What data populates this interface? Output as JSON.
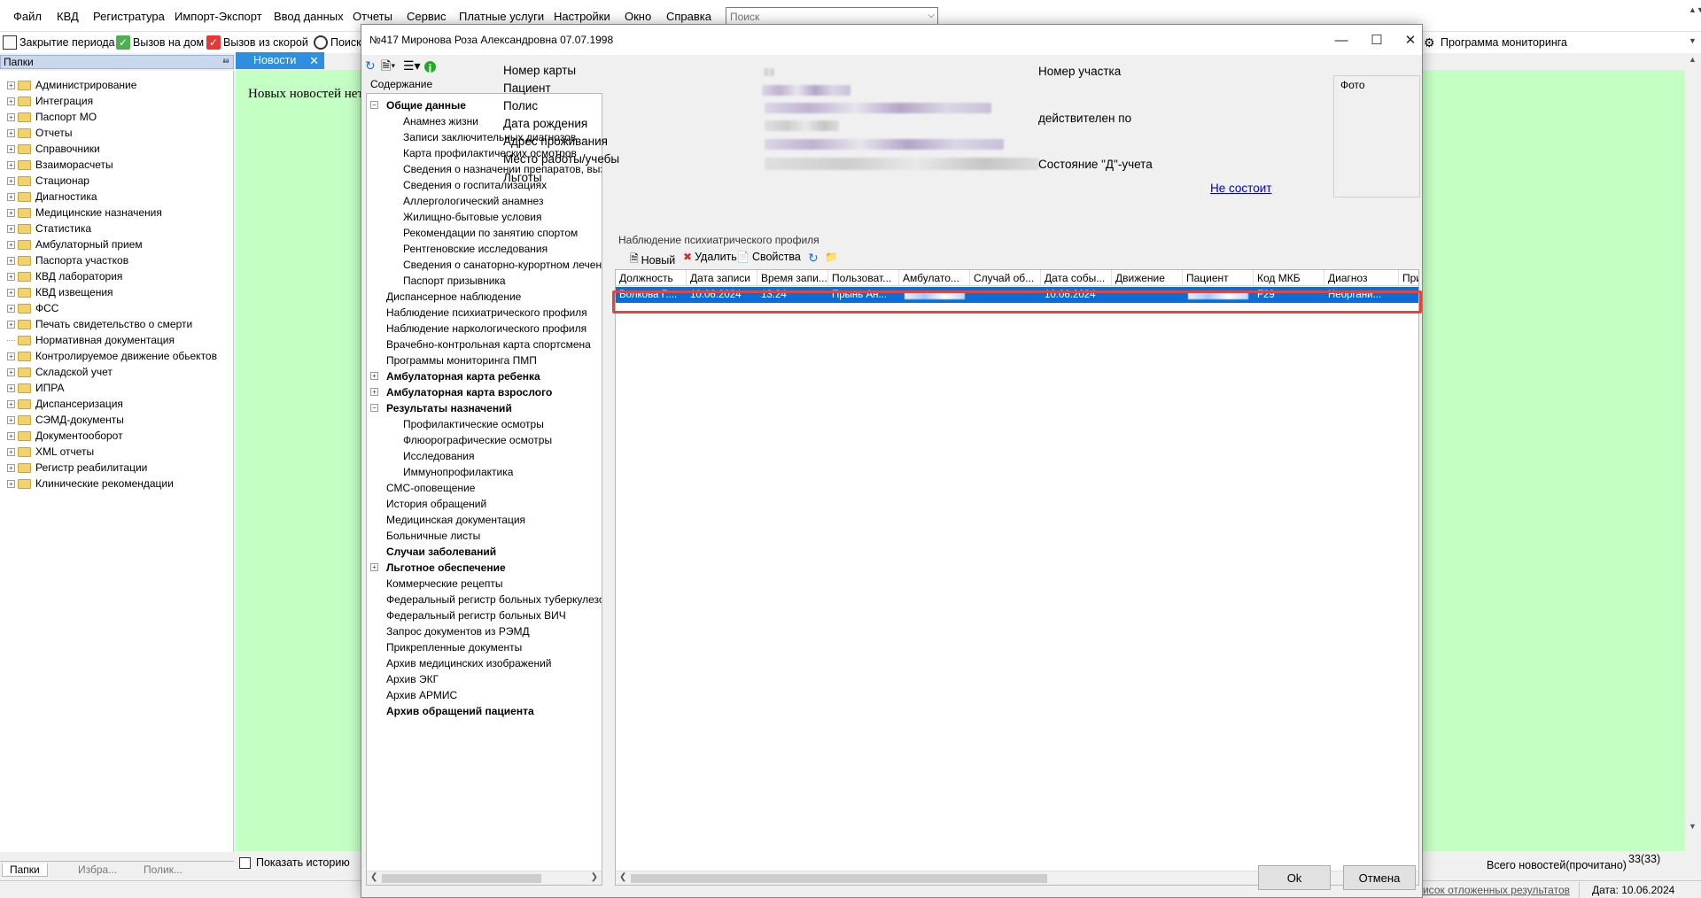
{
  "menubar": {
    "items": [
      "Файл",
      "КВД",
      "Регистратура",
      "Импорт-Экспорт",
      "Ввод данных",
      "Отчеты",
      "Сервис",
      "Платные услуги",
      "Настройки",
      "Окно",
      "Справка"
    ],
    "search_placeholder": "Поиск"
  },
  "toolbar": {
    "close_period": "Закрытие периода",
    "home_call": "Вызов на дом",
    "ambulance_call": "Вызов из скорой",
    "search": "Поиск",
    "monitoring": "Программа мониторинга"
  },
  "folders": {
    "title": "Папки",
    "items": [
      {
        "label": "Администрирование",
        "expandable": true
      },
      {
        "label": "Интеграция",
        "expandable": true
      },
      {
        "label": "Паспорт МО",
        "expandable": true
      },
      {
        "label": "Отчеты",
        "expandable": true
      },
      {
        "label": "Справочники",
        "expandable": true
      },
      {
        "label": "Взаиморасчеты",
        "expandable": true
      },
      {
        "label": "Стационар",
        "expandable": true
      },
      {
        "label": "Диагностика",
        "expandable": true
      },
      {
        "label": "Медицинские назначения",
        "expandable": true
      },
      {
        "label": "Статистика",
        "expandable": true
      },
      {
        "label": "Амбулаторный прием",
        "expandable": true
      },
      {
        "label": "Паспорта участков",
        "expandable": true
      },
      {
        "label": "КВД лаборатория",
        "expandable": true
      },
      {
        "label": "КВД извещения",
        "expandable": true
      },
      {
        "label": "ФСС",
        "expandable": true
      },
      {
        "label": "Печать свидетельство о смерти",
        "expandable": true
      },
      {
        "label": "Нормативная документация",
        "expandable": false
      },
      {
        "label": "Контролируемое движение обьектов",
        "expandable": true
      },
      {
        "label": "Складской учет",
        "expandable": true
      },
      {
        "label": "ИПРА",
        "expandable": true
      },
      {
        "label": "Диспансеризация",
        "expandable": true
      },
      {
        "label": "СЭМД-документы",
        "expandable": true
      },
      {
        "label": "Документооборот",
        "expandable": true
      },
      {
        "label": "XML отчеты",
        "expandable": true
      },
      {
        "label": "Регистр реабилитации",
        "expandable": true
      },
      {
        "label": "Клинические рекомендации",
        "expandable": true
      }
    ],
    "tabs": [
      "Папки",
      "Избра...",
      "Полик..."
    ]
  },
  "news": {
    "tab_label": "Новости",
    "empty_text": "Новых новостей нет",
    "show_history": "Показать историю",
    "total_label": "Всего новостей(прочитано)",
    "count": "33(33)"
  },
  "statusbar": {
    "link": "Список отложенных результатов",
    "date": "Дата: 10.06.2024"
  },
  "dialog": {
    "title": "№417 Миронова Роза Александровна 07.07.1998",
    "contents_label": "Содержание",
    "tree": [
      {
        "label": "Общие данные",
        "level": 0,
        "bold": true,
        "exp": "−"
      },
      {
        "label": "Анамнез жизни",
        "level": 1
      },
      {
        "label": "Записи заключительных диагнозов",
        "level": 1
      },
      {
        "label": "Карта профилактических осмотров",
        "level": 1
      },
      {
        "label": "Сведения о назначении препаратов, вызывающих",
        "level": 1
      },
      {
        "label": "Сведения о госпитализациях",
        "level": 1
      },
      {
        "label": "Аллергологический анамнез",
        "level": 1
      },
      {
        "label": "Жилищно-бытовые условия",
        "level": 1
      },
      {
        "label": "Рекомендации по занятию спортом",
        "level": 1
      },
      {
        "label": "Рентгеновские исследования",
        "level": 1
      },
      {
        "label": "Сведения о санаторно-курортном лечении",
        "level": 1
      },
      {
        "label": "Паспорт призывника",
        "level": 1
      },
      {
        "label": "Диспансерное наблюдение",
        "level": 0
      },
      {
        "label": "Наблюдение психиатрического профиля",
        "level": 0,
        "selected": true
      },
      {
        "label": "Наблюдение наркологического профиля",
        "level": 0
      },
      {
        "label": "Врачебно-контрольная карта спортсмена",
        "level": 0
      },
      {
        "label": "Программы мониторинга ПМП",
        "level": 0
      },
      {
        "label": "Амбулаторная карта ребенка",
        "level": 0,
        "bold": true,
        "exp": "+"
      },
      {
        "label": "Амбулаторная карта взрослого",
        "level": 0,
        "bold": true,
        "exp": "+"
      },
      {
        "label": "Результаты назначений",
        "level": 0,
        "bold": true,
        "exp": "−"
      },
      {
        "label": "Профилактические осмотры",
        "level": 1
      },
      {
        "label": "Флюорографические осмотры",
        "level": 1
      },
      {
        "label": "Исследования",
        "level": 1
      },
      {
        "label": "Иммунопрофилактика",
        "level": 1
      },
      {
        "label": "СМС-оповещение",
        "level": 0
      },
      {
        "label": "История обращений",
        "level": 0
      },
      {
        "label": "Медицинская документация",
        "level": 0
      },
      {
        "label": "Больничные листы",
        "level": 0
      },
      {
        "label": "Случаи заболеваний",
        "level": 0,
        "bold": true
      },
      {
        "label": "Льготное обеспечение",
        "level": 0,
        "bold": true,
        "exp": "+"
      },
      {
        "label": "Коммерческие рецепты",
        "level": 0
      },
      {
        "label": "Федеральный регистр больных туберкулезом",
        "level": 0
      },
      {
        "label": "Федеральный регистр больных ВИЧ",
        "level": 0
      },
      {
        "label": "Запрос документов из РЭМД",
        "level": 0
      },
      {
        "label": "Прикрепленные документы",
        "level": 0
      },
      {
        "label": "Архив медицинских изображений",
        "level": 0
      },
      {
        "label": "Архив ЭКГ",
        "level": 0
      },
      {
        "label": "Архив АРМИС",
        "level": 0
      },
      {
        "label": "Архив обращений пациента",
        "level": 0,
        "bold": true
      }
    ],
    "patient": {
      "card_number_label": "Номер карты",
      "patient_label": "Пациент",
      "policy_label": "Полис",
      "birth_date_label": "Дата рождения",
      "address_label": "Адрес проживания",
      "work_label": "Место работы/учебы",
      "benefits_label": "Льготы",
      "district_label": "Номер участка",
      "valid_until_label": "действителен по",
      "d_status_label": "Состояние \"Д\"-учета",
      "d_status_value": "Не состоит",
      "photo_label": "Фото"
    },
    "section_title": "Наблюдение психиатрического профиля",
    "grid_toolbar": {
      "new": "Новый",
      "delete": "Удалить",
      "properties": "Свойства"
    },
    "grid": {
      "columns": [
        "Должность",
        "Дата записи",
        "Время запи...",
        "Пользоват...",
        "Амбулато...",
        "Случай об...",
        "Дата собы...",
        "Движение",
        "Пациент",
        "Код МКБ",
        "Диагноз",
        "При..."
      ],
      "rows": [
        [
          "Волкова Г....",
          "10.06.2024",
          "13:24",
          "Прынь Ан...",
          "",
          "",
          "10.06.2024",
          "",
          "",
          "F29",
          "Неоргани...",
          ""
        ]
      ]
    },
    "buttons": {
      "ok": "Ok",
      "cancel": "Отмена"
    }
  }
}
